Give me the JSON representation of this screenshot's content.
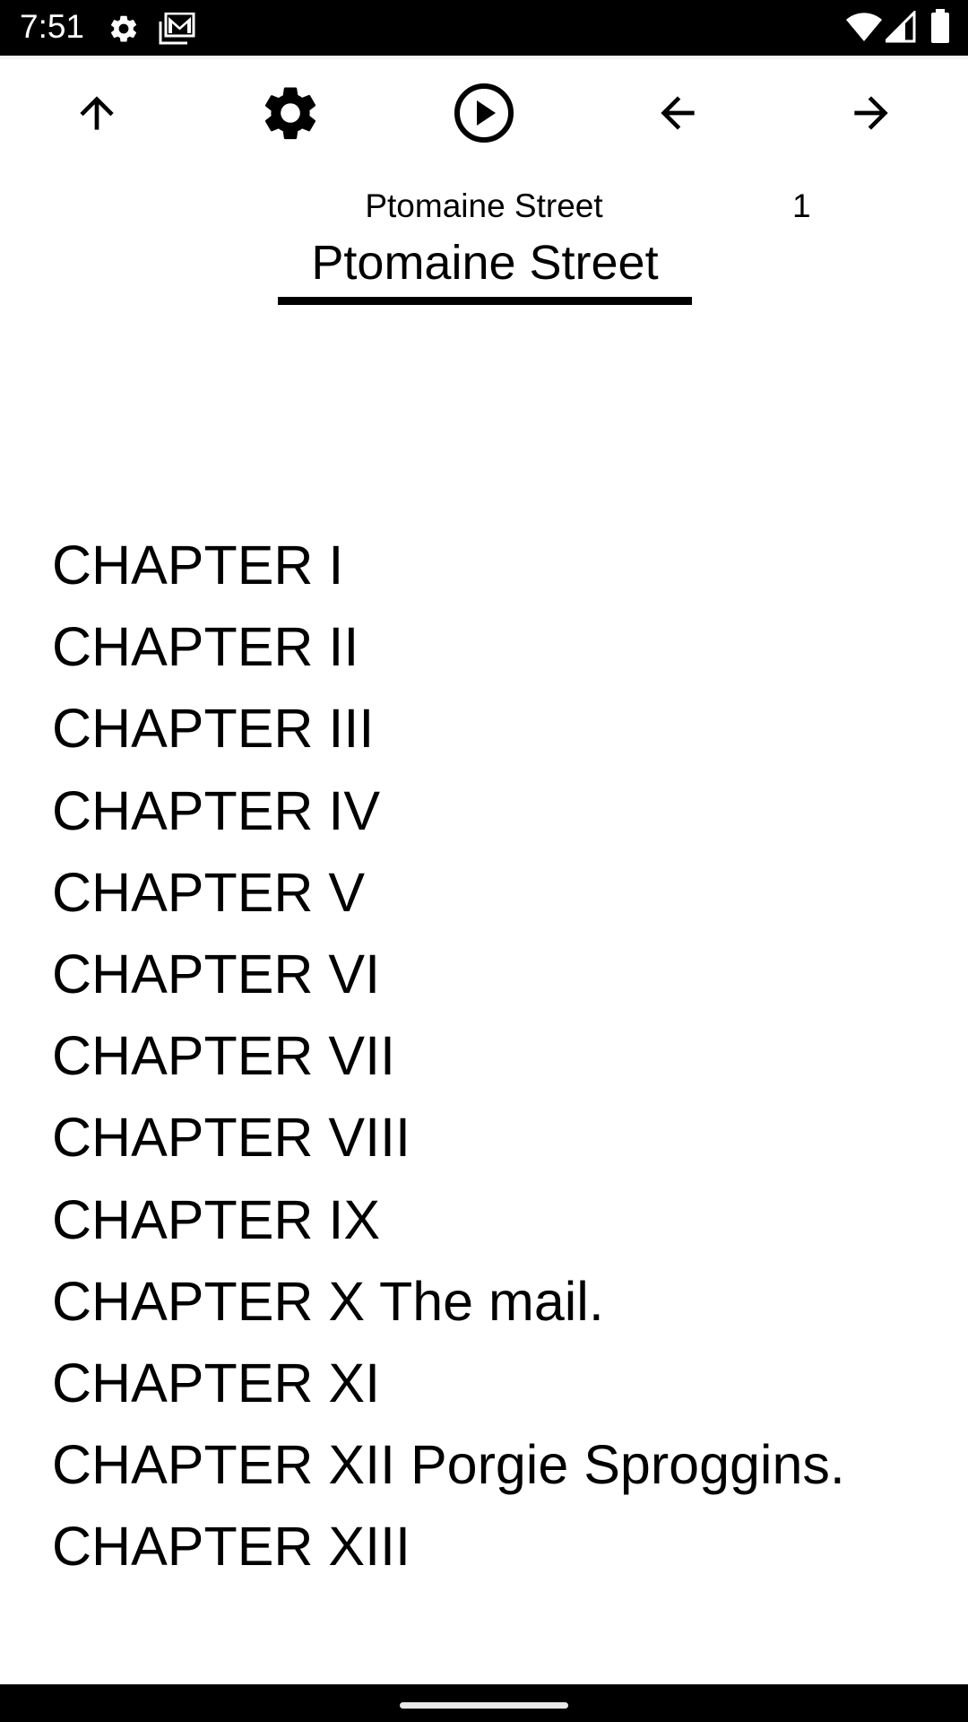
{
  "status_bar": {
    "time": "7:51",
    "left_icons": [
      "settings-icon",
      "gmail-icon"
    ],
    "right_icons": [
      "wifi-icon",
      "cellular-signal-icon",
      "battery-icon"
    ]
  },
  "toolbar": {
    "buttons": [
      {
        "name": "up",
        "icon": "arrow-up-icon"
      },
      {
        "name": "settings",
        "icon": "gear-icon"
      },
      {
        "name": "play",
        "icon": "play-circle-icon"
      },
      {
        "name": "previous",
        "icon": "arrow-left-icon"
      },
      {
        "name": "next",
        "icon": "arrow-right-icon"
      }
    ]
  },
  "header": {
    "book_title": "Ptomaine Street",
    "page_number": "1",
    "heading": "Ptomaine Street"
  },
  "chapters": [
    "CHAPTER I",
    "CHAPTER II",
    "CHAPTER III",
    "CHAPTER IV",
    "CHAPTER V",
    "CHAPTER VI",
    "CHAPTER VII",
    "CHAPTER VIII",
    "CHAPTER IX",
    "CHAPTER X The mail.",
    "CHAPTER XI",
    "CHAPTER XII Porgie Sproggins.",
    "CHAPTER XIII"
  ]
}
